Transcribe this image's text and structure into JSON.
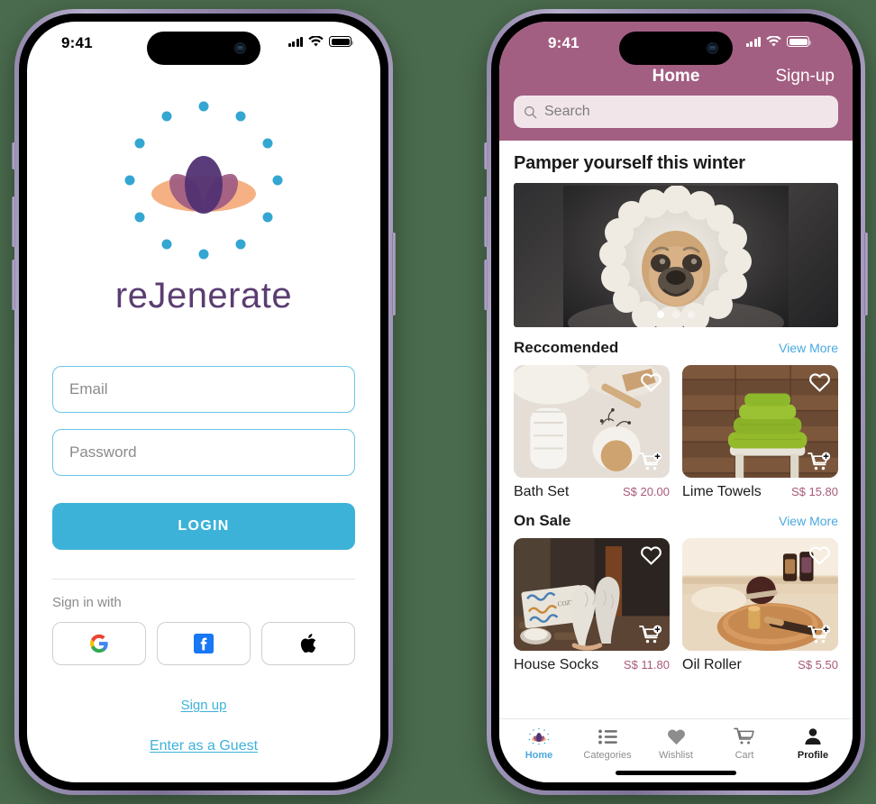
{
  "background_color": "#4a6b4d",
  "theme": {
    "accent_blue": "#3db2d9",
    "brand_purple": "#5b3d72",
    "header_mauve": "#a35f82",
    "price_mauve": "#a85a7a",
    "link_blue": "#4aa9e0"
  },
  "login_phone": {
    "status_bar": {
      "time": "9:41",
      "cellular_icon": "signal-bars-icon",
      "wifi_icon": "wifi-icon",
      "battery_icon": "battery-icon"
    },
    "logo": {
      "icon": "lotus-logo-icon",
      "dot_count": 12
    },
    "app_name": "reJenerate",
    "fields": [
      {
        "name": "email-field",
        "placeholder": "Email",
        "value": ""
      },
      {
        "name": "password-field",
        "placeholder": "Password",
        "value": ""
      }
    ],
    "login_button": "LOGIN",
    "social": {
      "label": "Sign in with",
      "providers": [
        {
          "name": "google-signin-button",
          "icon": "google-icon"
        },
        {
          "name": "facebook-signin-button",
          "icon": "facebook-icon"
        },
        {
          "name": "apple-signin-button",
          "icon": "apple-icon"
        }
      ]
    },
    "signup_link": "Sign up",
    "guest_link": "Enter as a Guest"
  },
  "shop_phone": {
    "status_bar": {
      "time": "9:41",
      "cellular_icon": "signal-bars-icon",
      "wifi_icon": "wifi-icon",
      "battery_icon": "battery-icon"
    },
    "nav": {
      "title": "Home",
      "action": "Sign-up"
    },
    "search": {
      "placeholder": "Search",
      "value": "",
      "icon": "search-icon"
    },
    "promo_title": "Pamper yourself this winter",
    "carousel": {
      "slide_count": 3,
      "active_index": 0,
      "image": "fluffy-dog-in-towel-photo"
    },
    "sections": [
      {
        "title": "Reccomended",
        "more": "View More",
        "products": [
          {
            "name": "Bath Set",
            "price": "S$ 20.00",
            "image": "bath-set-photo"
          },
          {
            "name": "Lime Towels",
            "price": "S$ 15.80",
            "image": "lime-towels-photo"
          }
        ]
      },
      {
        "title": "On Sale",
        "more": "View More",
        "products": [
          {
            "name": "House Socks",
            "price": "S$ 11.80",
            "image": "house-socks-photo"
          },
          {
            "name": "Oil Roller",
            "price": "S$ 5.50",
            "image": "oil-roller-photo"
          }
        ]
      }
    ],
    "tabs": [
      {
        "label": "Home",
        "icon": "lotus-logo-icon",
        "active": true
      },
      {
        "label": "Categories",
        "icon": "list-icon",
        "active": false
      },
      {
        "label": "Wishlist",
        "icon": "heart-filled-icon",
        "active": false
      },
      {
        "label": "Cart",
        "icon": "cart-icon",
        "active": false
      },
      {
        "label": "Profile",
        "icon": "person-icon",
        "active": false
      }
    ]
  }
}
